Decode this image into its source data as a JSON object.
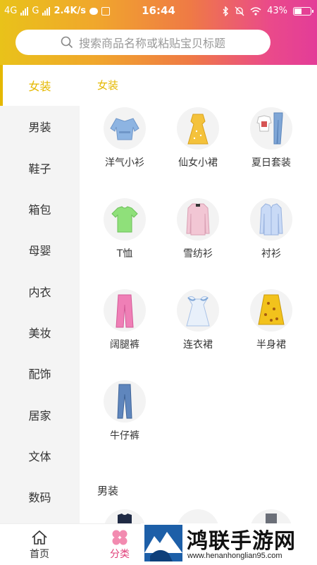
{
  "status_bar": {
    "network_1": "4G",
    "network_2": "G",
    "speed": "2.4K/s",
    "time": "16:44",
    "battery": "43%",
    "battery_level": 0.43
  },
  "search": {
    "placeholder": "搜索商品名称或粘贴宝贝标题"
  },
  "sidebar": {
    "items": [
      {
        "label": "女装",
        "active": true
      },
      {
        "label": "男装"
      },
      {
        "label": "鞋子"
      },
      {
        "label": "箱包"
      },
      {
        "label": "母婴"
      },
      {
        "label": "内衣"
      },
      {
        "label": "美妆"
      },
      {
        "label": "配饰"
      },
      {
        "label": "居家"
      },
      {
        "label": "文体"
      },
      {
        "label": "数码"
      }
    ]
  },
  "sections": [
    {
      "title": "女装",
      "items": [
        {
          "label": "洋气小衫",
          "icon": "blouse-icon"
        },
        {
          "label": "仙女小裙",
          "icon": "dress-yellow-icon"
        },
        {
          "label": "夏日套装",
          "icon": "summer-set-icon"
        },
        {
          "label": "T恤",
          "icon": "tshirt-icon"
        },
        {
          "label": "雪纺衫",
          "icon": "chiffon-shirt-icon"
        },
        {
          "label": "衬衫",
          "icon": "shirt-icon"
        },
        {
          "label": "阔腿裤",
          "icon": "wide-pants-icon"
        },
        {
          "label": "连衣裙",
          "icon": "dress-icon"
        },
        {
          "label": "半身裙",
          "icon": "skirt-icon"
        },
        {
          "label": "牛仔裤",
          "icon": "jeans-icon"
        }
      ]
    },
    {
      "title": "男装"
    }
  ],
  "bottom_nav": {
    "home": "首页",
    "category": "分类"
  },
  "watermark": {
    "title": "鸿联手游网",
    "url": "www.henanhonglian95.com"
  },
  "colors": {
    "accent": "#e5b800",
    "category_tab": "#e0407a"
  }
}
